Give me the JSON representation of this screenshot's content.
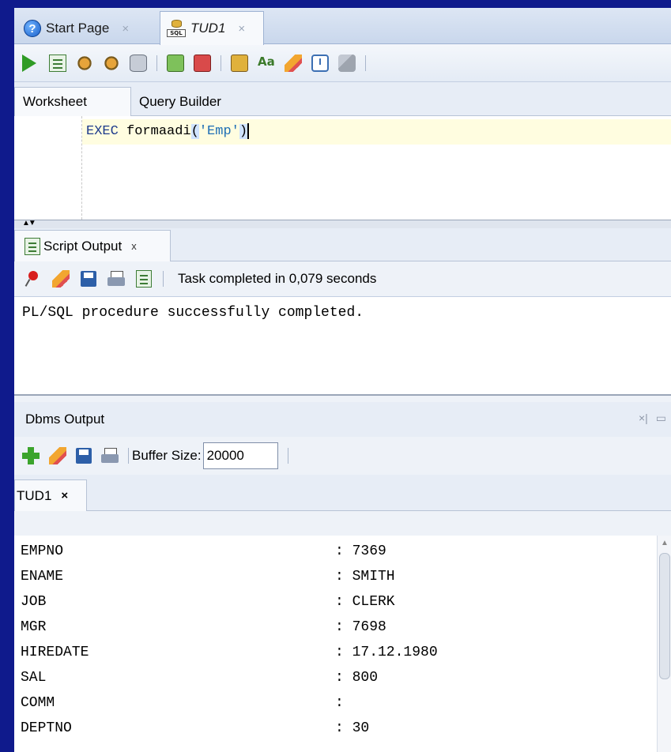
{
  "doc_tabs": [
    {
      "label": "Start Page",
      "icon": "help-icon"
    },
    {
      "label": "TUD1",
      "icon": "sql-worksheet-icon"
    }
  ],
  "toolbar": {
    "icons": [
      "run-statement-icon",
      "run-script-icon",
      "autotrace-icon",
      "explain-plan-icon",
      "sql-tuning-icon",
      "commit-icon",
      "rollback-icon",
      "sql-history-icon",
      "format-icon",
      "clear-icon",
      "unshared-worksheet-icon",
      "tuning-advisor-icon"
    ]
  },
  "worksheet_tabs": [
    {
      "label": "Worksheet"
    },
    {
      "label": "Query Builder"
    }
  ],
  "editor": {
    "keyword": "EXEC",
    "procedure": "formaadi",
    "open_paren": "(",
    "argument": "'Emp'",
    "close_paren": ")"
  },
  "script_output": {
    "tab_label": "Script Output",
    "tab_close": "x",
    "status": "Task completed in 0,079 seconds",
    "text": "PL/SQL procedure successfully completed."
  },
  "dbms_output": {
    "title": "Dbms Output",
    "buffer_label": "Buffer Size:",
    "buffer_value": "20000",
    "connection_tab": "TUD1",
    "rows": [
      {
        "key": "EMPNO",
        "value": ": 7369"
      },
      {
        "key": "ENAME",
        "value": ": SMITH"
      },
      {
        "key": "JOB",
        "value": ": CLERK"
      },
      {
        "key": "MGR",
        "value": ": 7698"
      },
      {
        "key": "HIREDATE",
        "value": ": 17.12.1980"
      },
      {
        "key": "SAL",
        "value": ": 800"
      },
      {
        "key": "COMM",
        "value": ":"
      },
      {
        "key": "DEPTNO",
        "value": ": 30"
      }
    ]
  },
  "colors": {
    "background": "#0f1a8c",
    "run_green": "#2f9b25",
    "keyword": "#1e3b8c",
    "string": "#1f6fb5"
  }
}
